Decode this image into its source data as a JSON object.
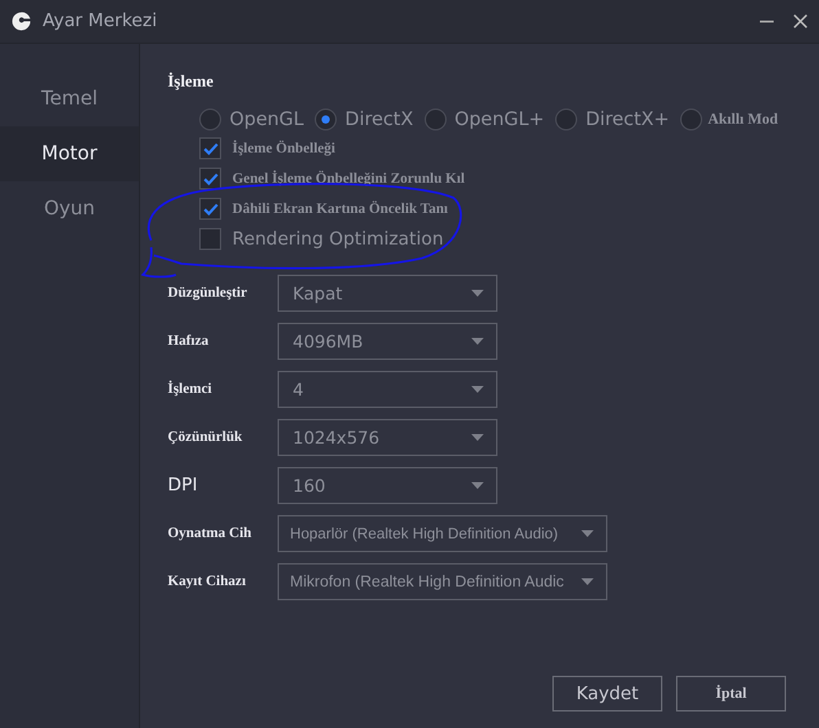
{
  "window": {
    "title": "Ayar Merkezi"
  },
  "sidebar": {
    "items": [
      {
        "label": "Temel",
        "selected": false
      },
      {
        "label": "Motor",
        "selected": true
      },
      {
        "label": "Oyun",
        "selected": false
      }
    ]
  },
  "rendering": {
    "title": "İşleme",
    "modes": [
      {
        "label": "OpenGL",
        "selected": false
      },
      {
        "label": "DirectX",
        "selected": true
      },
      {
        "label": "OpenGL+",
        "selected": false
      },
      {
        "label": "DirectX+",
        "selected": false
      },
      {
        "label": "Akıllı Mod",
        "selected": false
      }
    ],
    "options": [
      {
        "label": "İşleme Önbelleği",
        "checked": true
      },
      {
        "label": "Genel İşleme Önbelleğini Zorunlu Kıl",
        "checked": true
      },
      {
        "label": "Dâhili Ekran Kartına Öncelik Tanı",
        "checked": true
      },
      {
        "label": "Rendering Optimization",
        "checked": false
      }
    ]
  },
  "settings": [
    {
      "label": "Düzgünleştir",
      "value": "Kapat",
      "kind": "narrow"
    },
    {
      "label": "Hafıza",
      "value": "4096MB",
      "kind": "narrow"
    },
    {
      "label": "İşlemci",
      "value": "4",
      "kind": "narrow"
    },
    {
      "label": "Çözünürlük",
      "value": "1024x576",
      "kind": "narrow"
    },
    {
      "label": "DPI",
      "value": "160",
      "kind": "narrow"
    },
    {
      "label": "Oynatma Cih",
      "value": "Hoparlör (Realtek High Definition Audio)",
      "kind": "wide"
    },
    {
      "label": "Kayıt Cihazı",
      "value": "Mikrofon (Realtek High Definition Audic",
      "kind": "wide"
    }
  ],
  "buttons": [
    {
      "label": "Kaydet"
    },
    {
      "label": "İptal"
    }
  ]
}
